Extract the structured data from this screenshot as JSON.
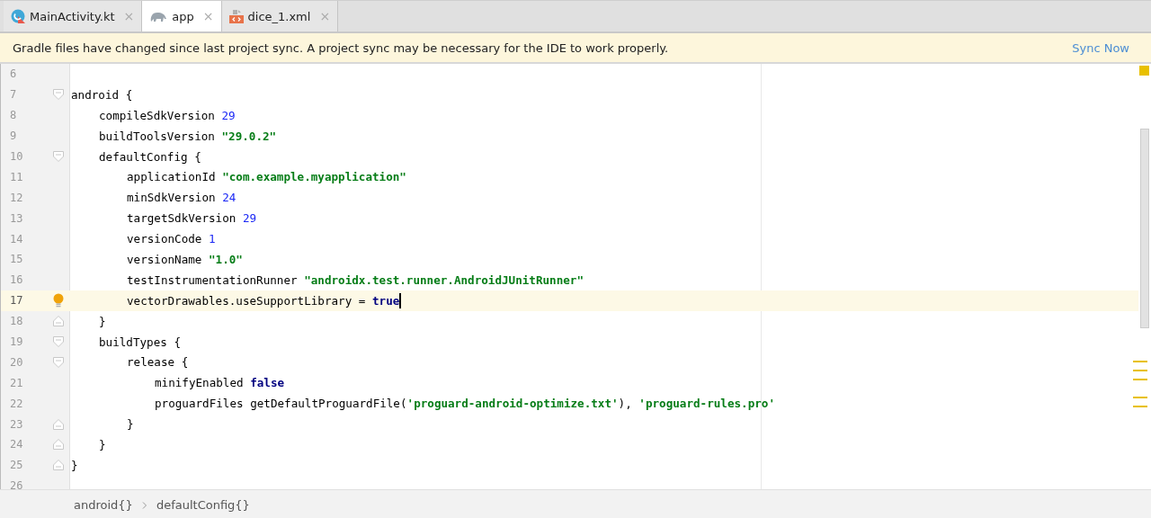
{
  "tabs": [
    {
      "label": "MainActivity.kt",
      "kind": "kotlin",
      "close": "×",
      "selected": false
    },
    {
      "label": "app",
      "kind": "gradle",
      "close": "×",
      "selected": true
    },
    {
      "label": "dice_1.xml",
      "kind": "xml",
      "close": "×",
      "selected": false
    }
  ],
  "banner": {
    "message": "Gradle files have changed since last project sync. A project sync may be necessary for the IDE to work properly.",
    "action": "Sync Now"
  },
  "editor": {
    "lines": [
      {
        "number": "6",
        "kind": "plain",
        "current": false
      },
      {
        "number": "7",
        "kind": "open",
        "current": false,
        "tokens": [
          {
            "kind": "plain",
            "text": "android {"
          }
        ],
        "children": [
          {
            "number": "8",
            "kind": "plain",
            "current": false,
            "tokens": [
              {
                "kind": "plain",
                "text": "compileSdkVersion "
              },
              {
                "kind": "number",
                "text": "29"
              }
            ]
          },
          {
            "number": "9",
            "kind": "plain",
            "current": false,
            "tokens": [
              {
                "kind": "plain",
                "text": "buildToolsVersion "
              },
              {
                "kind": "string",
                "text": "\"29.0.2\""
              }
            ]
          },
          {
            "number": "10",
            "kind": "open",
            "current": false,
            "tokens": [
              {
                "kind": "plain",
                "text": "defaultConfig {"
              }
            ],
            "children": [
              {
                "number": "11",
                "kind": "plain",
                "current": false,
                "tokens": [
                  {
                    "kind": "plain",
                    "text": "applicationId "
                  },
                  {
                    "kind": "string",
                    "text": "\"com.example.myapplication\""
                  }
                ]
              },
              {
                "number": "12",
                "kind": "plain",
                "current": false,
                "tokens": [
                  {
                    "kind": "plain",
                    "text": "minSdkVersion "
                  },
                  {
                    "kind": "number",
                    "text": "24"
                  }
                ]
              },
              {
                "number": "13",
                "kind": "plain",
                "current": false,
                "tokens": [
                  {
                    "kind": "plain",
                    "text": "targetSdkVersion "
                  },
                  {
                    "kind": "number",
                    "text": "29"
                  }
                ]
              },
              {
                "number": "14",
                "kind": "plain",
                "current": false,
                "tokens": [
                  {
                    "kind": "plain",
                    "text": "versionCode "
                  },
                  {
                    "kind": "number",
                    "text": "1"
                  }
                ]
              },
              {
                "number": "15",
                "kind": "plain",
                "current": false,
                "tokens": [
                  {
                    "kind": "plain",
                    "text": "versionName "
                  },
                  {
                    "kind": "string",
                    "text": "\"1.0\""
                  }
                ]
              },
              {
                "number": "16",
                "kind": "plain",
                "current": false,
                "tokens": [
                  {
                    "kind": "plain",
                    "text": "testInstrumentationRunner "
                  },
                  {
                    "kind": "string",
                    "text": "\"androidx.test.runner.AndroidJUnitRunner\""
                  }
                ]
              },
              {
                "number": "17",
                "kind": "plain",
                "current": true,
                "tokens": [
                  {
                    "kind": "plain",
                    "text": "vectorDrawables.useSupportLibrary = "
                  },
                  {
                    "kind": "keyword",
                    "text": "true"
                  }
                ]
              }
            ]
          },
          {
            "number": "18",
            "kind": "close",
            "current": false,
            "tokens": [
              {
                "kind": "plain",
                "text": "}"
              }
            ]
          },
          {
            "number": "19",
            "kind": "open",
            "current": false,
            "tokens": [
              {
                "kind": "plain",
                "text": "buildTypes {"
              }
            ],
            "children": [
              {
                "number": "20",
                "kind": "open",
                "current": false,
                "tokens": [
                  {
                    "kind": "plain",
                    "text": "release {"
                  }
                ],
                "children": [
                  {
                    "number": "21",
                    "kind": "plain",
                    "current": false,
                    "tokens": [
                      {
                        "kind": "plain",
                        "text": "minifyEnabled "
                      },
                      {
                        "kind": "keyword",
                        "text": "false"
                      }
                    ]
                  },
                  {
                    "number": "22",
                    "kind": "plain",
                    "current": false,
                    "tokens": [
                      {
                        "kind": "plain",
                        "text": "proguardFiles getDefaultProguardFile("
                      },
                      {
                        "kind": "string",
                        "text": "'proguard-android-optimize.txt'"
                      },
                      {
                        "kind": "plain",
                        "text": "), "
                      },
                      {
                        "kind": "string",
                        "text": "'proguard-rules.pro'"
                      }
                    ]
                  }
                ]
              },
              {
                "number": "23",
                "kind": "close",
                "current": false,
                "tokens": [
                  {
                    "kind": "plain",
                    "text": "}"
                  }
                ]
              }
            ]
          },
          {
            "number": "24",
            "kind": "close",
            "current": false,
            "tokens": [
              {
                "kind": "plain",
                "text": "}"
              }
            ]
          }
        ]
      },
      {
        "number": "25",
        "kind": "close",
        "current": false,
        "tokens": [
          {
            "kind": "plain",
            "text": "}"
          }
        ]
      },
      {
        "number": "26",
        "kind": "plain",
        "current": false
      }
    ]
  },
  "breadcrumbs": [
    "android{}",
    "defaultConfig{}"
  ]
}
